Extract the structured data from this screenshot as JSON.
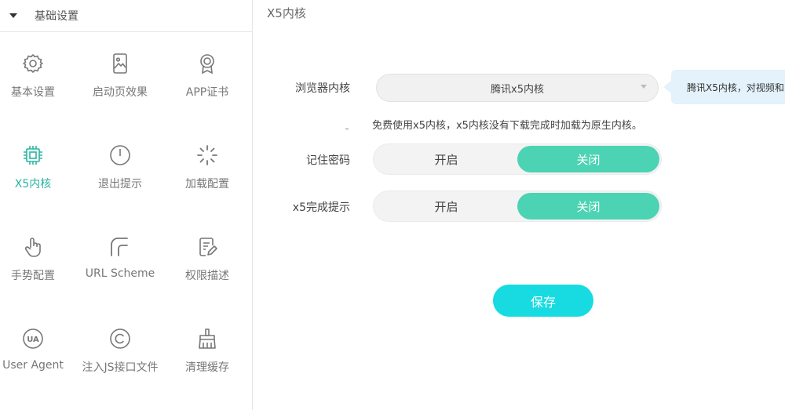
{
  "sidebar": {
    "section_title": "基础设置",
    "items": [
      {
        "label": "基本设置",
        "icon": "gear-icon",
        "active": false
      },
      {
        "label": "启动页效果",
        "icon": "image-phone-icon",
        "active": false
      },
      {
        "label": "APP证书",
        "icon": "certificate-icon",
        "active": false
      },
      {
        "label": "X5内核",
        "icon": "chip-icon",
        "active": true
      },
      {
        "label": "退出提示",
        "icon": "power-icon",
        "active": false
      },
      {
        "label": "加载配置",
        "icon": "loading-spinner-icon",
        "active": false
      },
      {
        "label": "手势配置",
        "icon": "hand-gesture-icon",
        "active": false
      },
      {
        "label": "URL Scheme",
        "icon": "scheme-link-icon",
        "active": false
      },
      {
        "label": "权限描述",
        "icon": "document-edit-icon",
        "active": false
      },
      {
        "label": "User Agent",
        "icon": "ua-badge-icon",
        "active": false
      },
      {
        "label": "注入JS接口文件",
        "icon": "copyright-icon",
        "active": false
      },
      {
        "label": "清理缓存",
        "icon": "broom-icon",
        "active": false
      }
    ]
  },
  "main": {
    "title": "X5内核",
    "browser_kernel": {
      "label": "浏览器内核",
      "value": "腾讯x5内核",
      "tooltip": "腾讯X5内核，对视频和"
    },
    "hint": "免费使用x5内核，x5内核没有下载完成时加载为原生内核。",
    "remember_password": {
      "label": "记住密码",
      "on_label": "开启",
      "off_label": "关闭",
      "selected": "关闭"
    },
    "x5_complete_tip": {
      "label": "x5完成提示",
      "on_label": "开启",
      "off_label": "关闭",
      "selected": "关闭"
    },
    "save_label": "保存"
  },
  "colors": {
    "accent": "#4cd3b3",
    "active_text": "#2bb5a0",
    "save_button": "#17dbe0",
    "tooltip_bg": "#e3f2fb"
  }
}
